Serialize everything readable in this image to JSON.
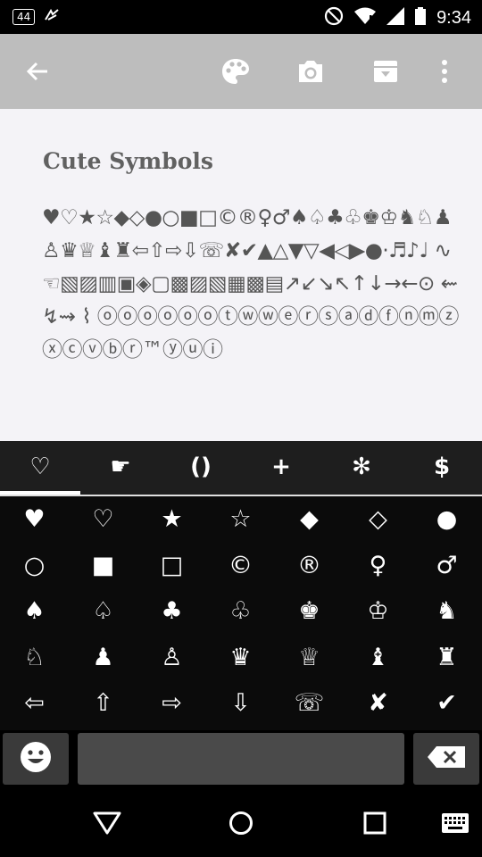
{
  "status_bar": {
    "notification_badge": "44",
    "time": "9:34",
    "icons": [
      "notification-badge-icon",
      "app-notification-icon",
      "do-not-disturb-icon",
      "wifi-icon",
      "cell-signal-icon",
      "battery-icon"
    ]
  },
  "app_bar": {
    "icons": [
      "back-arrow-icon",
      "palette-icon",
      "camera-icon",
      "archive-icon",
      "more-vert-icon"
    ]
  },
  "note": {
    "title": "Cute Symbols",
    "body": "♥♡★☆◆◇●○■□©®♀♂♠♤♣♧♚♔♞♘♟♙♛♕♝♜⇦⇧⇨⇩☏✘✔▲△▼▽◀◁▶●·♬♪♩ ∿ ☜▧▨▥▣◈▢▩▨▧▦▩▤↗↙↘↖↑↓→←⊙ ⇜↯⇝ ⌇ ⓞⓞⓞⓞⓞⓞⓣⓦⓦⓔⓡⓢⓐⓓⓕⓝⓜⓩⓧⓒⓥⓑⓡ™ⓨⓤⓘ"
  },
  "tabs": [
    {
      "label": "♡",
      "name": "tab-hearts"
    },
    {
      "label": "☛",
      "name": "tab-hands"
    },
    {
      "label": "()",
      "name": "tab-brackets"
    },
    {
      "label": "+",
      "name": "tab-math"
    },
    {
      "label": "✻",
      "name": "tab-stars"
    },
    {
      "label": "$",
      "name": "tab-currency"
    }
  ],
  "keyboard": {
    "rows": [
      [
        "♥",
        "♡",
        "★",
        "☆",
        "◆",
        "◇",
        "●"
      ],
      [
        "○",
        "■",
        "□",
        "©",
        "®",
        "♀",
        "♂"
      ],
      [
        "♠",
        "♤",
        "♣",
        "♧",
        "♚",
        "♔",
        "♞"
      ],
      [
        "♘",
        "♟",
        "♙",
        "♛",
        "♕",
        "♝",
        "♜"
      ],
      [
        "⇦",
        "⇧",
        "⇨",
        "⇩",
        "☏",
        "✘",
        "✔"
      ]
    ],
    "bottom_icons": [
      "emoji-icon",
      "backspace-icon"
    ]
  },
  "nav_bar": {
    "icons": [
      "back-triangle-icon",
      "home-circle-icon",
      "recents-square-icon",
      "keyboard-icon"
    ]
  }
}
